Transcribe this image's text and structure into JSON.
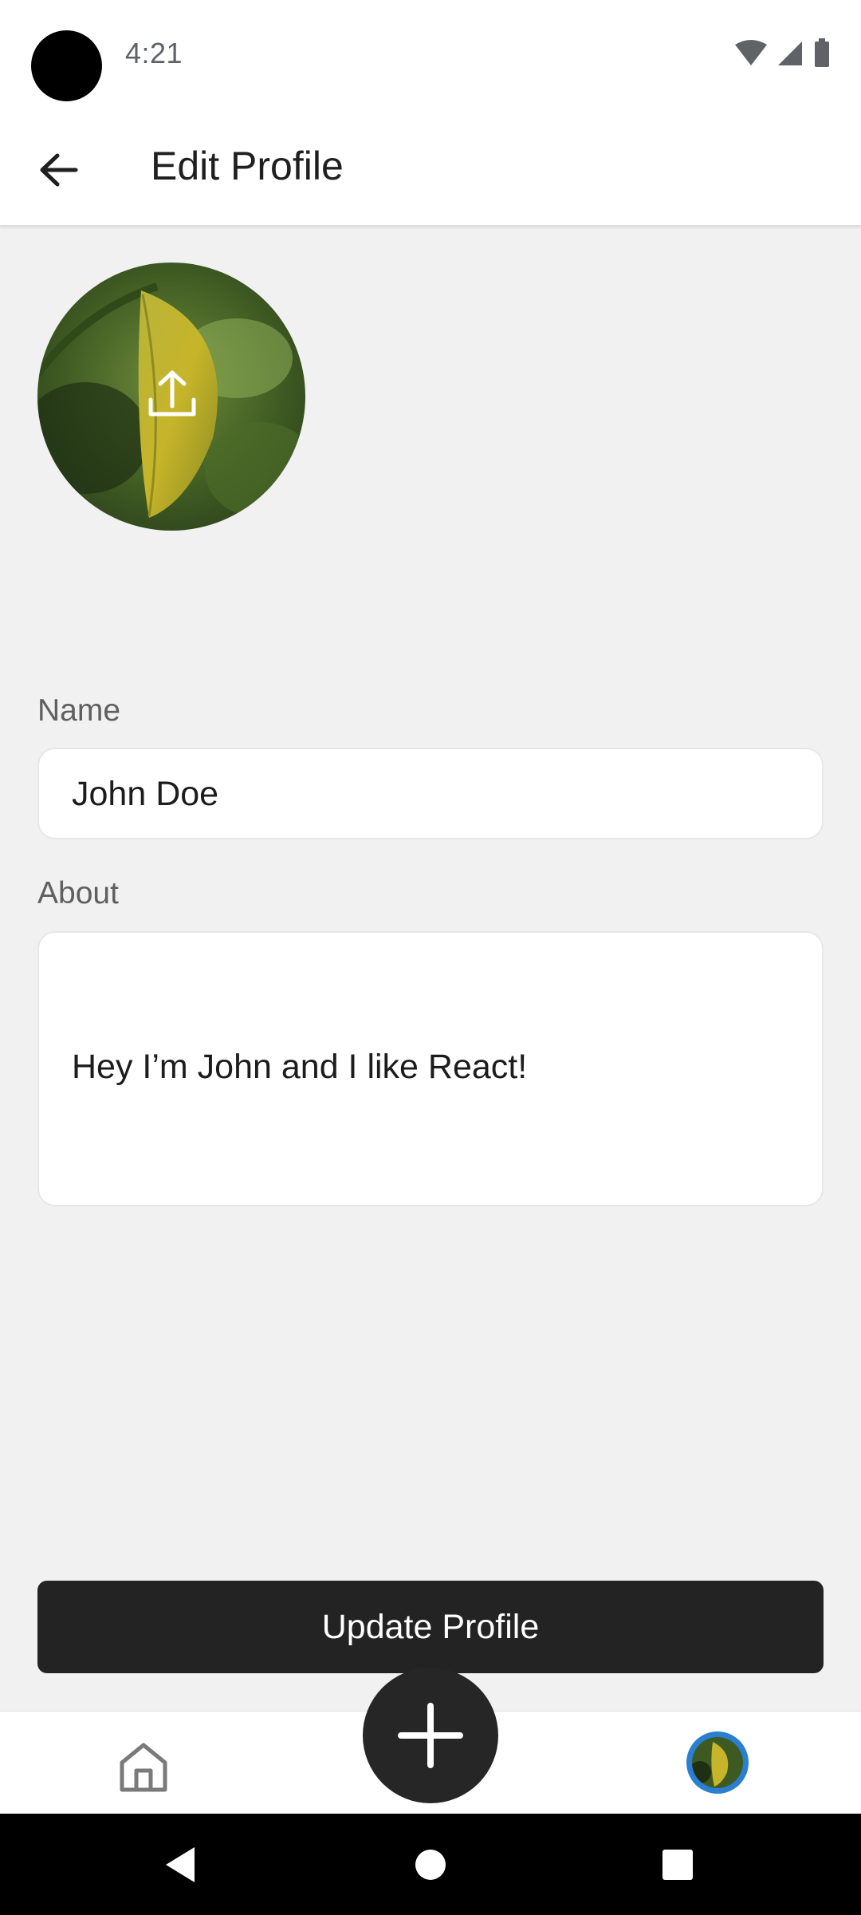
{
  "status_bar": {
    "time": "4:21",
    "icons": [
      "wifi-icon",
      "signal-icon",
      "battery-icon"
    ]
  },
  "app_bar": {
    "title": "Edit Profile",
    "back_icon": "arrow-left-icon"
  },
  "avatar": {
    "overlay_icon": "upload-icon"
  },
  "form": {
    "name": {
      "label": "Name",
      "value": "John Doe"
    },
    "about": {
      "label": "About",
      "value": "Hey I’m John and I like React!"
    }
  },
  "update_button": {
    "label": "Update Profile"
  },
  "tab_bar": {
    "items": [
      "home-icon",
      "plus-icon",
      "profile-avatar"
    ]
  },
  "colors": {
    "background": "#f1f1f1",
    "button": "#232323",
    "profile_ring": "#2b7fd3"
  }
}
